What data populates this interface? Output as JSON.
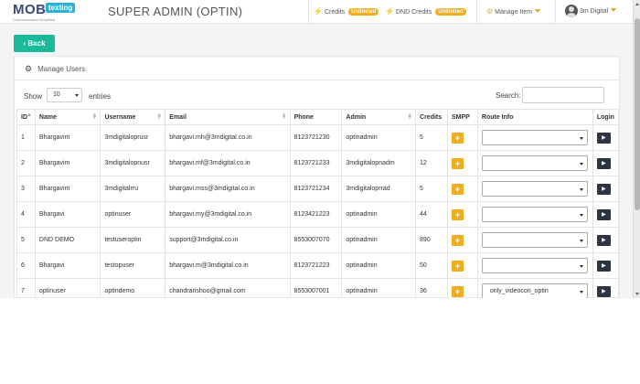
{
  "brand": {
    "mob": "MOB",
    "texting": "texting",
    "tagline": "Communication Simplified"
  },
  "header": {
    "title": "SUPER ADMIN (OPTIN)",
    "credits_label": "Credits",
    "credits_badge": "Unlimited",
    "dnd_label": "DND Credits",
    "dnd_badge": "Unlimited",
    "manage_label": "Manage Item",
    "user_name": "3m Digital"
  },
  "back_label": "Back",
  "panel_title": "Manage Users",
  "controls": {
    "show_label": "Show",
    "page_length": "10",
    "entries_label": "entries",
    "search_label": "Search:",
    "search_value": ""
  },
  "columns": [
    "ID",
    "Name",
    "Username",
    "Email",
    "Phone",
    "Admin",
    "Credits",
    "SMPP",
    "Route Info",
    "Login"
  ],
  "rows": [
    {
      "id": "1",
      "name": "Bhargavim",
      "username": "3mdigitaloprusr",
      "email": "bhargavi.mh@3mdigital.co.in",
      "phone": "8123721230",
      "admin": "optinadmin",
      "credits": "5",
      "smpp": "+",
      "route": ""
    },
    {
      "id": "2",
      "name": "Bhargavim",
      "username": "3mdigitalopnusr",
      "email": "bhargavi.mf@3mdigital.co.in",
      "phone": "8123721233",
      "admin": "3mdigitalopnadm",
      "credits": "12",
      "smpp": "+",
      "route": ""
    },
    {
      "id": "3",
      "name": "Bhargavim",
      "username": "3mdigitalrru",
      "email": "bhargavi.mss@3mdigital.co.in",
      "phone": "8123721234",
      "admin": "3mdigitaloprrad",
      "credits": "5",
      "smpp": "+",
      "route": ""
    },
    {
      "id": "4",
      "name": "Bhargavi",
      "username": "optinuser",
      "email": "bhargavi.my@3mdigital.co.in",
      "phone": "8123421223",
      "admin": "optinadmin",
      "credits": "44",
      "smpp": "+",
      "route": ""
    },
    {
      "id": "5",
      "name": "DND DEMO",
      "username": "testuseroptin",
      "email": "support@3mdigital.co.in",
      "phone": "8553007070",
      "admin": "optinadmin",
      "credits": "890",
      "smpp": "+",
      "route": ""
    },
    {
      "id": "6",
      "name": "Bhargavi",
      "username": "testopuser",
      "email": "bhargavi.m@3mdigital.co.in",
      "phone": "8123721223",
      "admin": "optinadmin",
      "credits": "50",
      "smpp": "+",
      "route": ""
    },
    {
      "id": "7",
      "name": "optinuser",
      "username": "optindemo",
      "email": "chandrarishoo@gmail.com",
      "phone": "8553007001",
      "admin": "optinadmin",
      "credits": "36",
      "smpp": "+",
      "route": "only_videocon_optin"
    }
  ],
  "colors": {
    "accent": "#1bb99a",
    "warning": "#f0ad1c",
    "dark": "#2b3544"
  }
}
